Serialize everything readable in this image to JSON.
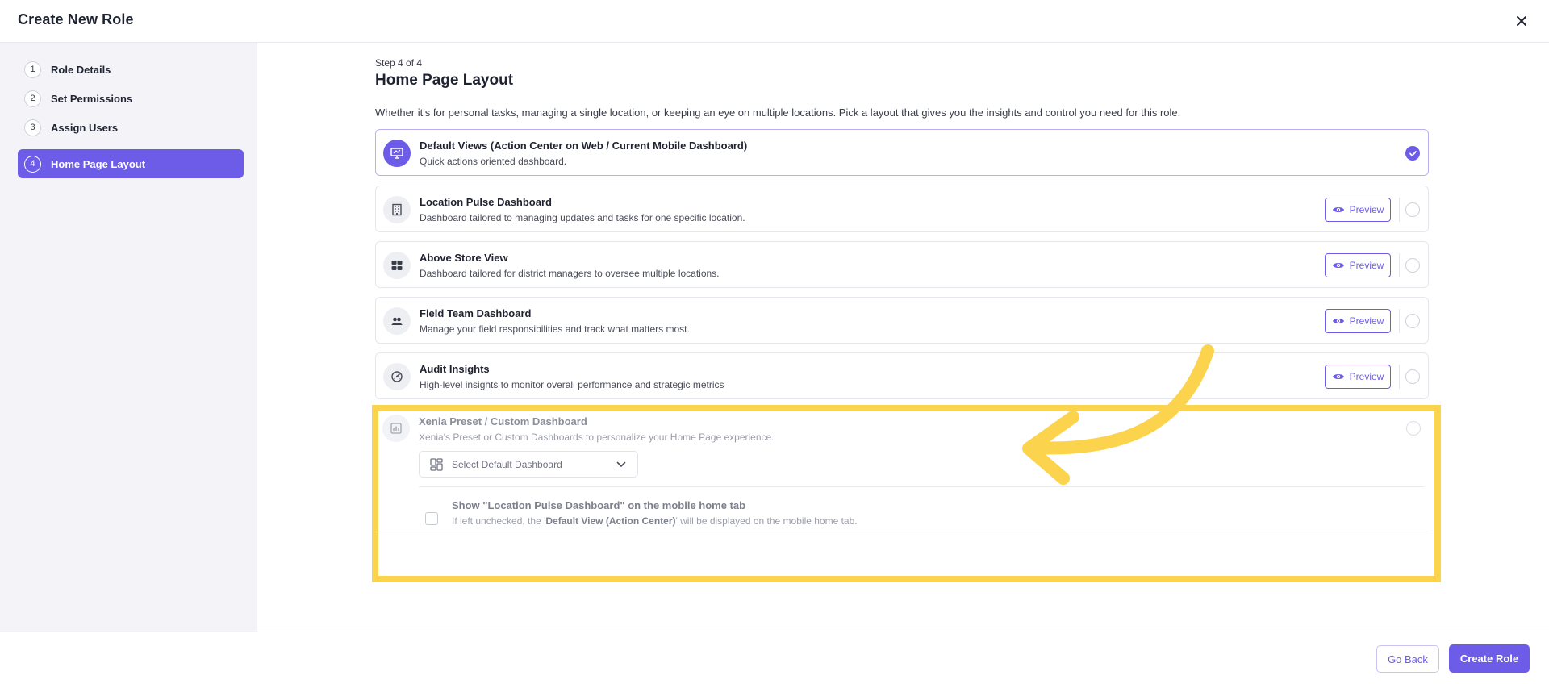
{
  "header": {
    "title": "Create New Role"
  },
  "sidebar": {
    "steps": [
      {
        "num": "1",
        "label": "Role Details"
      },
      {
        "num": "2",
        "label": "Set Permissions"
      },
      {
        "num": "3",
        "label": "Assign Users"
      },
      {
        "num": "4",
        "label": "Home Page Layout"
      }
    ],
    "active_step": "4"
  },
  "main": {
    "step_of": "Step 4 of 4",
    "title": "Home Page Layout",
    "description": "Whether it's for personal tasks, managing a single location, or keeping an eye on multiple locations. Pick a layout that gives you the insights and control you need for this role.",
    "preview_label": "Preview",
    "layouts": [
      {
        "title": "Default Views (Action Center on Web / Current Mobile Dashboard)",
        "sub": "Quick actions oriented dashboard.",
        "icon": "monitor-icon",
        "selected": true
      },
      {
        "title": "Location Pulse Dashboard",
        "sub": "Dashboard tailored to managing updates and tasks for one specific location.",
        "icon": "building-icon",
        "selected": false
      },
      {
        "title": "Above Store View",
        "sub": "Dashboard tailored for district managers to oversee multiple locations.",
        "icon": "grid-icon",
        "selected": false
      },
      {
        "title": "Field Team Dashboard",
        "sub": "Manage your field responsibilities and track what matters most.",
        "icon": "users-icon",
        "selected": false
      },
      {
        "title": "Audit Insights",
        "sub": "High-level insights to monitor overall performance and strategic metrics",
        "icon": "gauge-icon",
        "selected": false
      }
    ],
    "xenia": {
      "title": "Xenia Preset / Custom Dashboard",
      "sub": "Xenia's Preset or Custom Dashboards to personalize your Home Page experience.",
      "select_label": "Select Default Dashboard",
      "checkbox_title": "Show \"Location Pulse Dashboard\" on the mobile home tab",
      "checkbox_sub_pre": "If left unchecked, the '",
      "checkbox_sub_bold": "Default View (Action Center)",
      "checkbox_sub_post": "' will be displayed on the mobile home tab."
    }
  },
  "footer": {
    "back_label": "Go Back",
    "create_label": "Create Role"
  },
  "colors": {
    "accent": "#6c5ce7",
    "highlight": "#fcd34d"
  }
}
